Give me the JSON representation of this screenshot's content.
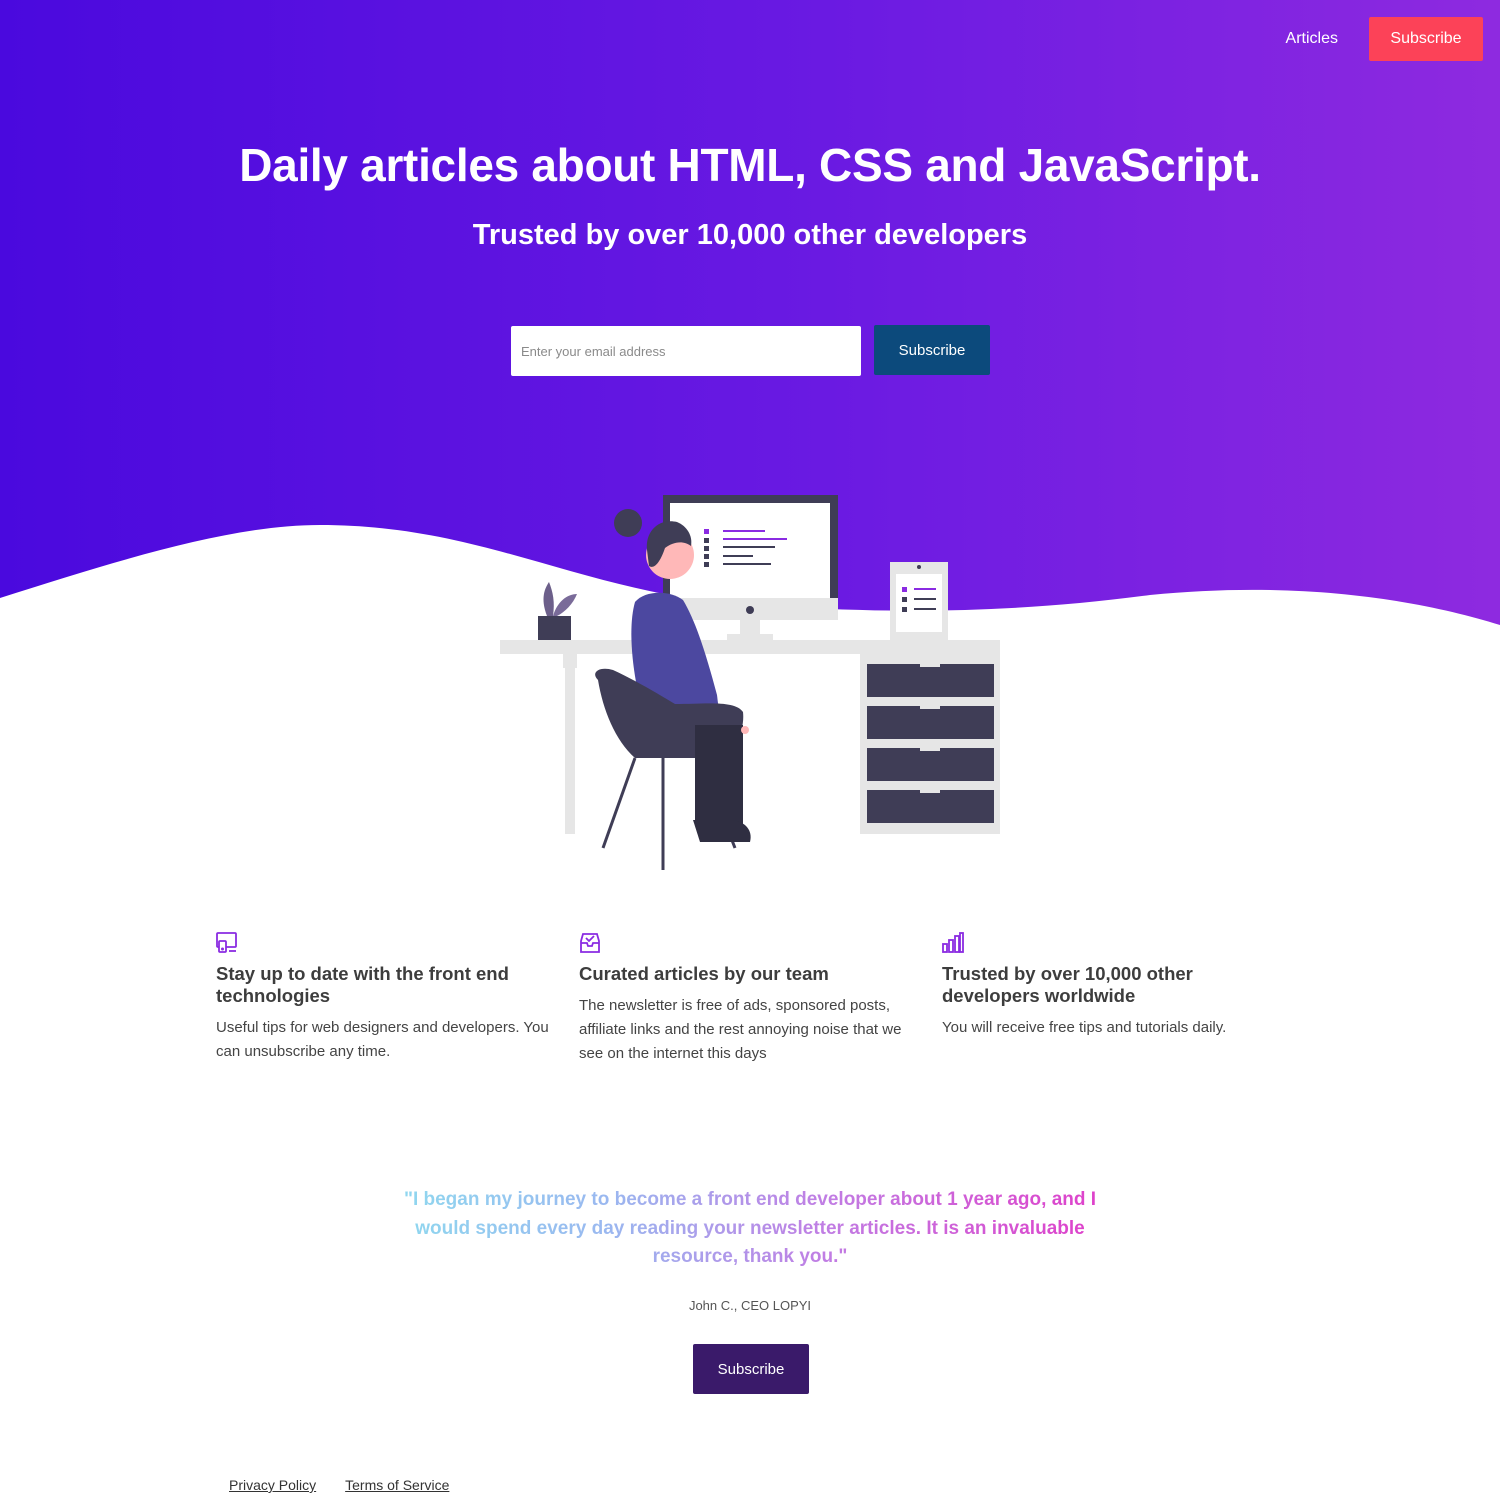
{
  "nav": {
    "articles_label": "Articles",
    "subscribe_label": "Subscribe"
  },
  "hero": {
    "title": "Daily articles about HTML, CSS and JavaScript.",
    "subtitle": "Trusted by over 10,000 other developers",
    "email_placeholder": "Enter your email address",
    "subscribe_label": "Subscribe"
  },
  "features": [
    {
      "icon": "devices-icon",
      "title": "Stay up to date with the front end technologies",
      "text": "Useful tips for web designers and developers. You can unsubscribe any time."
    },
    {
      "icon": "inbox-icon",
      "title": "Curated articles by our team",
      "text": "The newsletter is free of ads, sponsored posts, affiliate links and the rest annoying noise that we see on the internet this days"
    },
    {
      "icon": "bar-chart-icon",
      "title": "Trusted by over 10,000 other developers worldwide",
      "text": "You will receive free tips and tutorials daily."
    }
  ],
  "testimonial": {
    "quote": "\"I began my journey to become a front end developer about 1 year ago, and I would spend every day reading your newsletter articles. It is an invaluable resource, thank you.\"",
    "author": "John C., CEO LOPYI",
    "subscribe_label": "Subscribe"
  },
  "footer": {
    "privacy": "Privacy Policy",
    "terms": "Terms of Service"
  },
  "colors": {
    "hero_gradient_start": "#4a09de",
    "hero_gradient_end": "#8e2ae0",
    "nav_subscribe": "#fc4258",
    "hero_subscribe": "#0c4a7c",
    "bottom_subscribe": "#3a1a6a",
    "accent_purple": "#8a2be2"
  }
}
